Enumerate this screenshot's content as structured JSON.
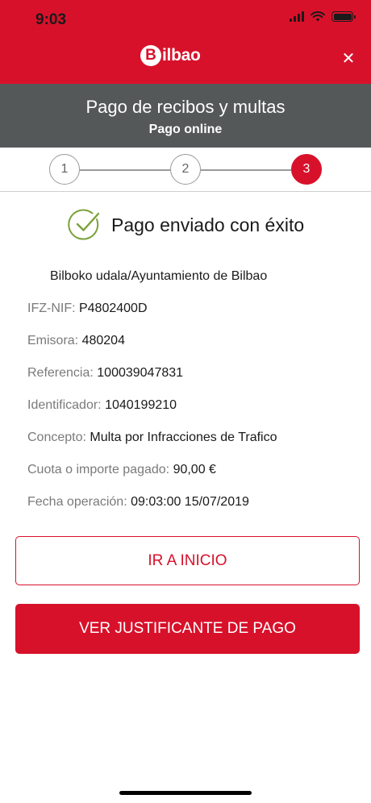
{
  "status_bar": {
    "time": "9:03"
  },
  "header": {
    "logo_initial": "B",
    "logo_rest": "ilbao",
    "close_glyph": "✕"
  },
  "title_band": {
    "title": "Pago de recibos y multas",
    "subtitle": "Pago online"
  },
  "stepper": {
    "steps": [
      "1",
      "2",
      "3"
    ],
    "active_step": 3
  },
  "result": {
    "message": "Pago enviado con éxito"
  },
  "details": {
    "entity": "Bilboko udala/Ayuntamiento de Bilbao",
    "rows": [
      {
        "label": "IFZ-NIF: ",
        "value": "P4802400D"
      },
      {
        "label": "Emisora: ",
        "value": "480204"
      },
      {
        "label": "Referencia: ",
        "value": "100039047831"
      },
      {
        "label": "Identificador: ",
        "value": "1040199210"
      },
      {
        "label": "Concepto: ",
        "value": "Multa por Infracciones de Trafico"
      },
      {
        "label": "Cuota o importe pagado: ",
        "value": "90,00 €"
      },
      {
        "label": "Fecha operación: ",
        "value": "09:03:00 15/07/2019"
      }
    ]
  },
  "actions": {
    "home_label": "IR A INICIO",
    "receipt_label": "VER JUSTIFICANTE DE PAGO"
  },
  "colors": {
    "brand_red": "#d8112b",
    "band_gray": "#545859",
    "success_green": "#7aa13a"
  }
}
